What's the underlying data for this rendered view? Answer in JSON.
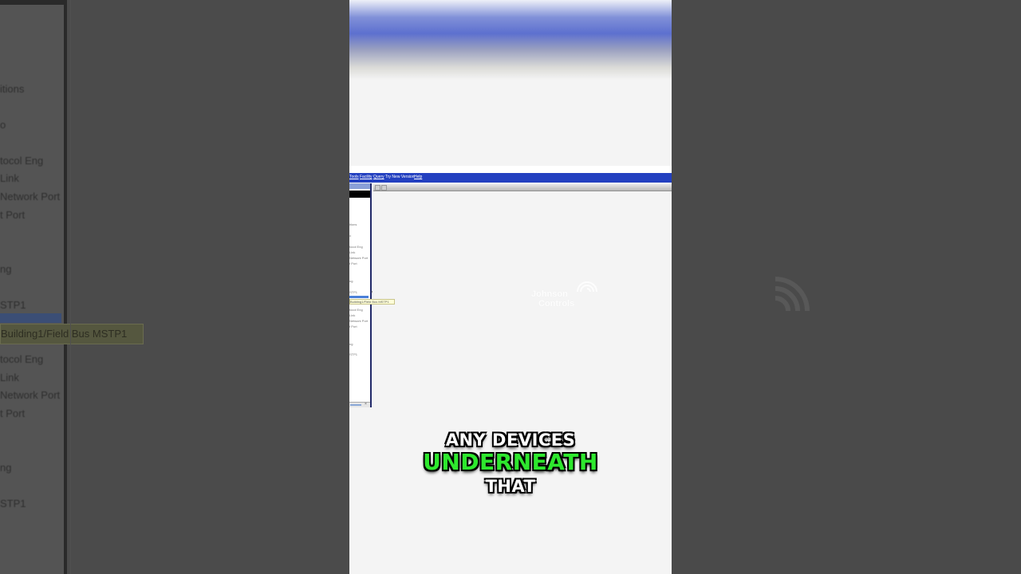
{
  "background": {
    "nav_items": [
      "itions",
      "o",
      "tocol Eng",
      "Link",
      "Network Port",
      "t Port",
      "ng",
      "STP1",
      "tocol Eng",
      "Link",
      "Network Port",
      "t Port",
      "ng",
      "STP1"
    ],
    "tooltip": "Building1/Field Bus MSTP1"
  },
  "app": {
    "menu": [
      {
        "label": "Tools",
        "underline": true
      },
      {
        "label": "Facility",
        "underline": true
      },
      {
        "label": "Query",
        "underline": true
      },
      {
        "label": "Try New Version",
        "underline": false
      },
      {
        "label": "Help",
        "underline": true
      }
    ],
    "tree_items": [
      "itions",
      "o",
      "tocol Eng",
      "Link",
      "Network Port",
      "t Port",
      "ng",
      "STP1",
      "tocol Eng",
      "Link",
      "Network Port",
      "t Port",
      "ng",
      "STP1"
    ],
    "tooltip": "Building1/Field Bus MSTP1",
    "logo_text_line1": "Johnson",
    "logo_text_line2": "Controls"
  },
  "captions": {
    "line1": "ANY DEVICES",
    "line2": "UNDERNEATH",
    "line3": "THAT"
  },
  "colors": {
    "menu_bar": "#2340c0",
    "caption_highlight": "#2ee82e"
  }
}
